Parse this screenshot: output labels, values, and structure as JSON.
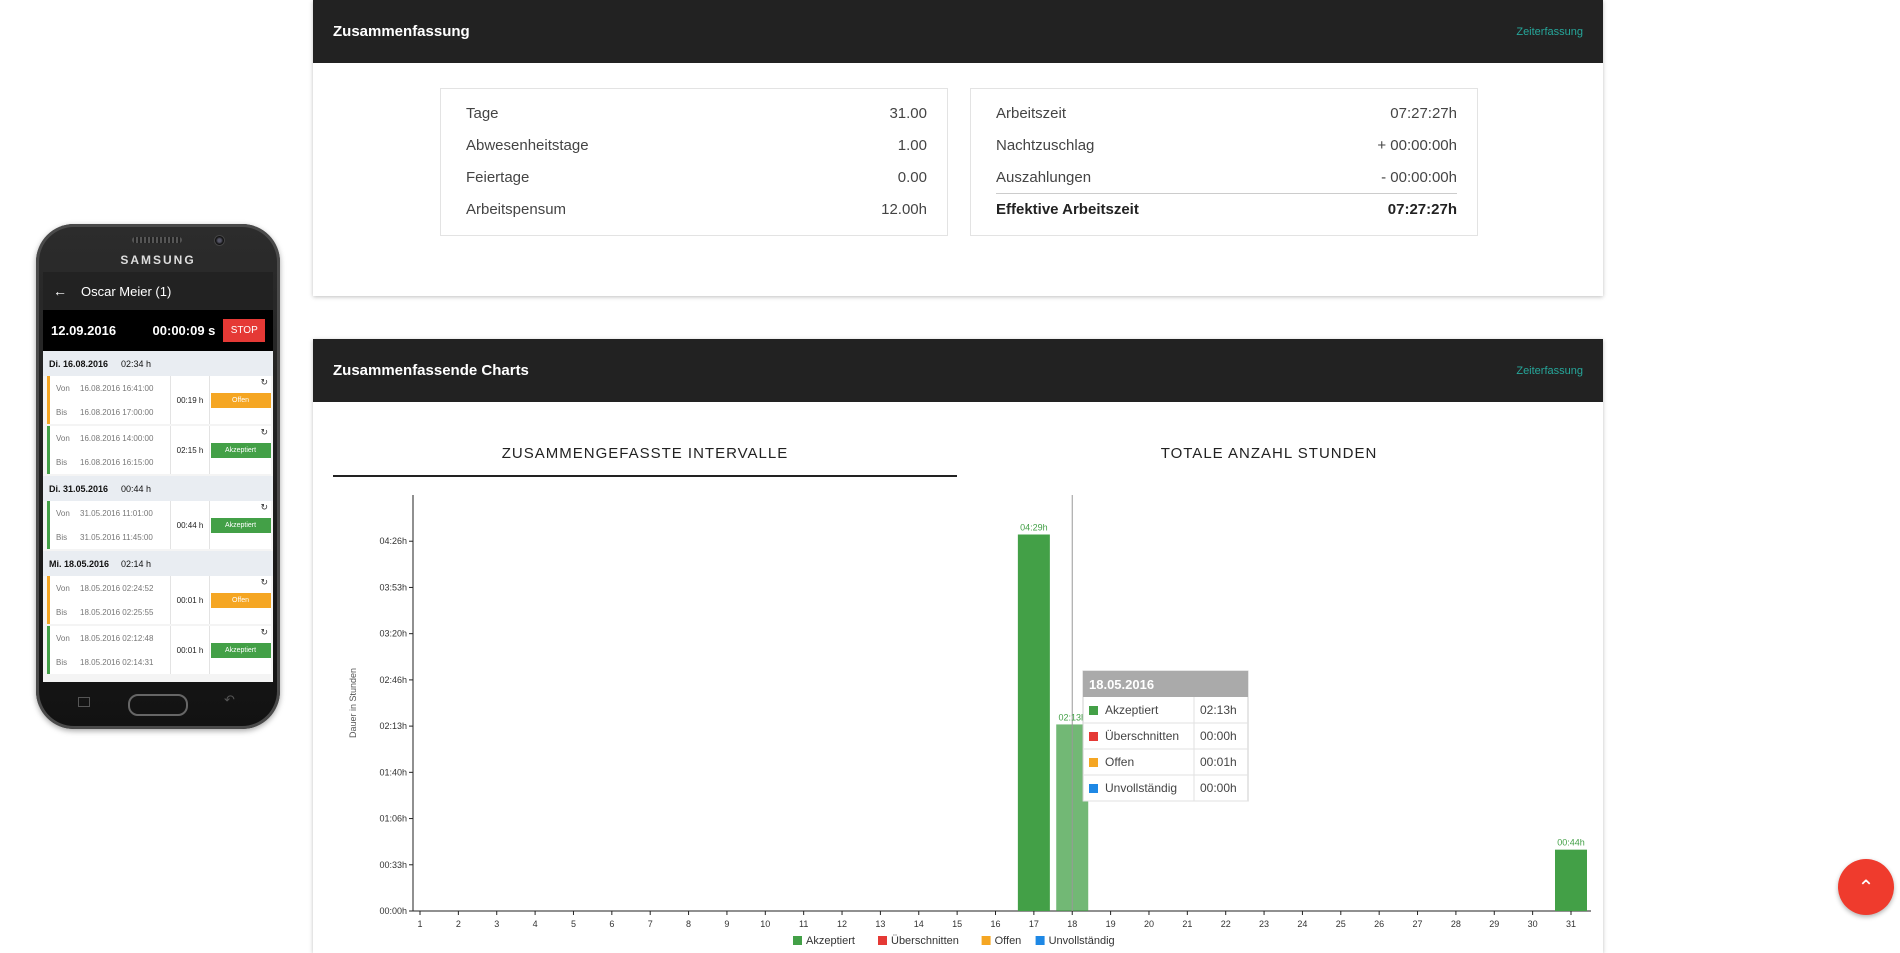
{
  "phone": {
    "brand": "SAMSUNG",
    "title": "Oscar Meier (1)",
    "timer": {
      "date": "12.09.2016",
      "time": "00:00:09 s",
      "stop_label": "STOP"
    },
    "days": [
      {
        "label": "Di. 16.08.2016",
        "total": "02:34 h",
        "entries": [
          {
            "von_label": "Von",
            "von": "16.08.2016 16:41:00",
            "bis_label": "Bis",
            "bis": "16.08.2016 17:00:00",
            "duration": "00:19 h",
            "status": "Offen"
          },
          {
            "von_label": "Von",
            "von": "16.08.2016 14:00:00",
            "bis_label": "Bis",
            "bis": "16.08.2016 16:15:00",
            "duration": "02:15 h",
            "status": "Akzeptiert"
          }
        ]
      },
      {
        "label": "Di. 31.05.2016",
        "total": "00:44 h",
        "entries": [
          {
            "von_label": "Von",
            "von": "31.05.2016 11:01:00",
            "bis_label": "Bis",
            "bis": "31.05.2016 11:45:00",
            "duration": "00:44 h",
            "status": "Akzeptiert"
          }
        ]
      },
      {
        "label": "Mi. 18.05.2016",
        "total": "02:14 h",
        "entries": [
          {
            "von_label": "Von",
            "von": "18.05.2016 02:24:52",
            "bis_label": "Bis",
            "bis": "18.05.2016 02:25:55",
            "duration": "00:01 h",
            "status": "Offen"
          },
          {
            "von_label": "Von",
            "von": "18.05.2016 02:12:48",
            "bis_label": "Bis",
            "bis": "18.05.2016 02:14:31",
            "duration": "00:01 h",
            "status": "Akzeptiert"
          }
        ]
      }
    ]
  },
  "summary": {
    "title": "Zusammenfassung",
    "link": "Zeiterfassung",
    "left": [
      {
        "label": "Tage",
        "value": "31.00"
      },
      {
        "label": "Abwesenheitstage",
        "value": "1.00"
      },
      {
        "label": "Feiertage",
        "value": "0.00"
      },
      {
        "label": "Arbeitspensum",
        "value": "12.00h"
      }
    ],
    "right": [
      {
        "label": "Arbeitszeit",
        "value": "07:27:27h"
      },
      {
        "label": "Nachtzuschlag",
        "value": "+ 00:00:00h"
      },
      {
        "label": "Auszahlungen",
        "value": "- 00:00:00h"
      }
    ],
    "total": {
      "label": "Effektive Arbeitszeit",
      "value": "07:27:27h"
    }
  },
  "charts_card": {
    "title": "Zusammenfassende Charts",
    "link": "Zeiterfassung",
    "tabs": [
      {
        "label": "ZUSAMMENGEFASSTE INTERVALLE",
        "active": true
      },
      {
        "label": "TOTALE ANZAHL STUNDEN",
        "active": false
      }
    ]
  },
  "chart_data": {
    "type": "bar",
    "ylabel": "Dauer in Stunden",
    "ylim": [
      0,
      4.95
    ],
    "ytick_values": [
      0,
      0.55,
      1.1,
      1.65,
      2.2,
      2.75,
      3.3,
      3.85,
      4.4
    ],
    "ytick_labels": [
      "00:00h",
      "00:33h",
      "01:06h",
      "01:40h",
      "02:13h",
      "02:46h",
      "03:20h",
      "03:53h",
      "04:26h"
    ],
    "categories": [
      "1",
      "2",
      "3",
      "4",
      "5",
      "6",
      "7",
      "8",
      "9",
      "10",
      "11",
      "12",
      "13",
      "14",
      "15",
      "16",
      "17",
      "18",
      "19",
      "20",
      "21",
      "22",
      "23",
      "24",
      "25",
      "26",
      "27",
      "28",
      "29",
      "30",
      "31"
    ],
    "series": [
      {
        "name": "Akzeptiert",
        "color": "#43a047",
        "values": [
          0,
          0,
          0,
          0,
          0,
          0,
          0,
          0,
          0,
          0,
          0,
          0,
          0,
          0,
          0,
          0,
          4.48,
          2.22,
          0,
          0,
          0,
          0,
          0,
          0,
          0,
          0,
          0,
          0,
          0,
          0,
          0.73
        ]
      },
      {
        "name": "Überschnitten",
        "color": "#e53935",
        "values": [
          0,
          0,
          0,
          0,
          0,
          0,
          0,
          0,
          0,
          0,
          0,
          0,
          0,
          0,
          0,
          0,
          0,
          0,
          0,
          0,
          0,
          0,
          0,
          0,
          0,
          0,
          0,
          0,
          0,
          0,
          0
        ]
      },
      {
        "name": "Offen",
        "color": "#f5a623",
        "values": [
          0,
          0,
          0,
          0,
          0,
          0,
          0,
          0,
          0,
          0,
          0,
          0,
          0,
          0,
          0,
          0,
          0,
          0.02,
          0,
          0,
          0,
          0,
          0,
          0,
          0,
          0,
          0,
          0,
          0,
          0,
          0
        ]
      },
      {
        "name": "Unvollständig",
        "color": "#1e88e5",
        "values": [
          0,
          0,
          0,
          0,
          0,
          0,
          0,
          0,
          0,
          0,
          0,
          0,
          0,
          0,
          0,
          0,
          0,
          0,
          0,
          0,
          0,
          0,
          0,
          0,
          0,
          0,
          0,
          0,
          0,
          0,
          0
        ]
      }
    ],
    "data_labels": [
      {
        "category": "17",
        "text": "04:29h"
      },
      {
        "category": "18",
        "text": "02:13h"
      },
      {
        "category": "31",
        "text": "00:44h"
      }
    ],
    "highlighted_category": "18",
    "legend_position": "bottom-center",
    "tooltip": {
      "title": "18.05.2016",
      "rows": [
        {
          "name": "Akzeptiert",
          "value": "02:13h",
          "color": "#43a047"
        },
        {
          "name": "Überschnitten",
          "value": "00:00h",
          "color": "#e53935"
        },
        {
          "name": "Offen",
          "value": "00:01h",
          "color": "#f5a623"
        },
        {
          "name": "Unvollständig",
          "value": "00:00h",
          "color": "#1e88e5"
        }
      ]
    }
  },
  "fab": {
    "icon": "chevron-up-icon",
    "glyph": "⌃"
  }
}
